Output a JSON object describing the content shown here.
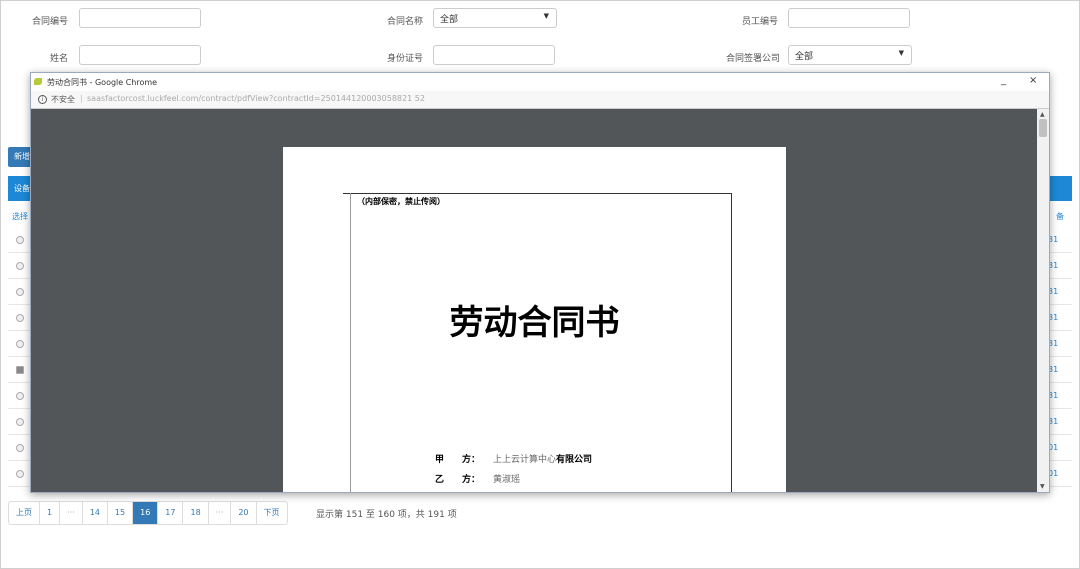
{
  "search_form": {
    "fields": [
      {
        "label": "合同编号",
        "type": "input",
        "value": ""
      },
      {
        "label": "合同名称",
        "type": "select",
        "value": "全部"
      },
      {
        "label": "员工编号",
        "type": "input",
        "value": ""
      },
      {
        "label": "姓名",
        "type": "input",
        "value": ""
      },
      {
        "label": "身份证号",
        "type": "input",
        "value": ""
      },
      {
        "label": "合同签署公司",
        "type": "select",
        "value": "全部"
      }
    ]
  },
  "table": {
    "new_button_label": "新增",
    "toolbar_label": "设备",
    "select_column": "选择",
    "right_column": "备",
    "row_tail_values": [
      "31",
      "31",
      "31",
      "31",
      "31",
      "31",
      "31",
      "31",
      "01",
      "01"
    ],
    "selected_row_index": 5
  },
  "pagination": {
    "prev_label": "上页",
    "pages": [
      "1",
      "···",
      "14",
      "15",
      "16",
      "17",
      "18",
      "···",
      "20"
    ],
    "active_page": "16",
    "next_label": "下页",
    "info": "显示第 151 至 160 项，共 191 项"
  },
  "popup": {
    "window_title": "劳动合同书 - Google Chrome",
    "minimize": "_",
    "close": "×",
    "insecure_label": "不安全",
    "url": "saasfactorcost.luckfeel.com/contract/pdfView?contractId=250144120003058821 52",
    "document": {
      "confidential_note": "（内部保密，禁止传阅）",
      "title": "劳动合同书",
      "party_a_label": "甲　　方：",
      "party_a_value_faded": "上上云计算中心",
      "party_a_value_bold": "有限公司",
      "party_b_label": "乙　　方：",
      "party_b_value": "黄淑瑶"
    }
  }
}
